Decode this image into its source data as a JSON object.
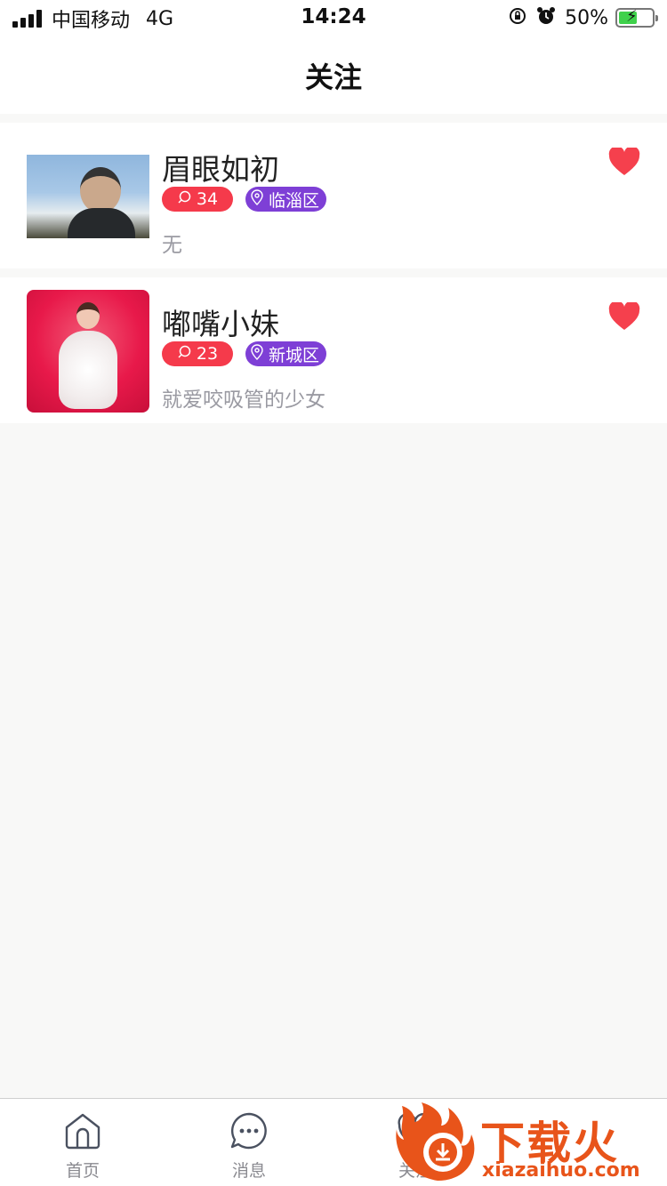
{
  "status_bar": {
    "carrier": "中国移动",
    "network": "4G",
    "time": "14:24",
    "battery_percent": "50%"
  },
  "nav": {
    "title": "关注"
  },
  "follow_list": [
    {
      "name": "眉眼如初",
      "comment_count": "34",
      "location": "临淄区",
      "bio": "无",
      "followed": true
    },
    {
      "name": "嘟嘴小妹",
      "comment_count": "23",
      "location": "新城区",
      "bio": "就爱咬吸管的少女",
      "followed": true
    }
  ],
  "tab_bar": {
    "tabs": [
      {
        "label": "首页",
        "icon": "home-icon"
      },
      {
        "label": "消息",
        "icon": "message-icon"
      },
      {
        "label": "关注",
        "icon": "follow-icon"
      }
    ]
  },
  "watermark": {
    "title": "下载火",
    "url": "xiazaihuo.com"
  },
  "colors": {
    "heart": "#f5404d",
    "comment_tag": "#f53a4b",
    "location_tag": "#7e3fd6",
    "watermark": "#e8541a"
  }
}
